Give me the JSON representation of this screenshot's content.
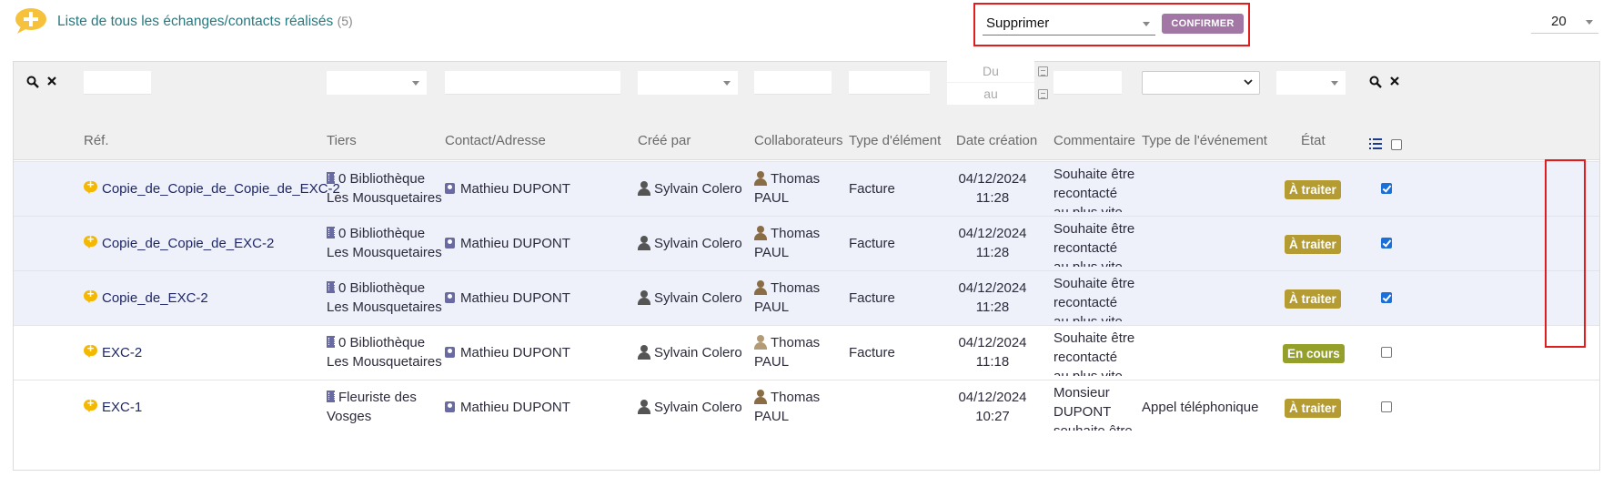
{
  "header": {
    "title": "Liste de tous les échanges/contacts réalisés",
    "count": "(5)",
    "mass_action": {
      "selected": "Supprimer",
      "confirm_label": "CONFIRMER"
    },
    "limit": "20"
  },
  "filters": {
    "date_from_placeholder": "Du",
    "date_to_placeholder": "au"
  },
  "columns": {
    "ref": "Réf.",
    "tiers": "Tiers",
    "contact": "Contact/Adresse",
    "created_by": "Créé par",
    "collaborators": "Collaborateurs",
    "element_type": "Type d'élément",
    "date_created": "Date création",
    "comment": "Commentaire",
    "event_type": "Type de l'événement",
    "state": "État"
  },
  "rows": [
    {
      "ref": "Copie_de_Copie_de_Copie_de_EXC-2",
      "tiers_1": "0 Bibliothèque",
      "tiers_2": "Les Mousquetaires",
      "contact": "Mathieu DUPONT",
      "created_by": "Sylvain Colero",
      "collab_1": "Thomas",
      "collab_2": "PAUL",
      "element_type": "Facture",
      "date": "04/12/2024",
      "time": "11:28",
      "comment_1": "Souhaite être",
      "comment_2": "recontacté",
      "comment_3": "au plus vite",
      "event_type": "",
      "state": "À traiter",
      "checked": true
    },
    {
      "ref": "Copie_de_Copie_de_EXC-2",
      "tiers_1": "0 Bibliothèque",
      "tiers_2": "Les Mousquetaires",
      "contact": "Mathieu DUPONT",
      "created_by": "Sylvain Colero",
      "collab_1": "Thomas",
      "collab_2": "PAUL",
      "element_type": "Facture",
      "date": "04/12/2024",
      "time": "11:28",
      "comment_1": "Souhaite être",
      "comment_2": "recontacté",
      "comment_3": "au plus vite",
      "event_type": "",
      "state": "À traiter",
      "checked": true
    },
    {
      "ref": "Copie_de_EXC-2",
      "tiers_1": "0 Bibliothèque",
      "tiers_2": "Les Mousquetaires",
      "contact": "Mathieu DUPONT",
      "created_by": "Sylvain Colero",
      "collab_1": "Thomas",
      "collab_2": "PAUL",
      "element_type": "Facture",
      "date": "04/12/2024",
      "time": "11:28",
      "comment_1": "Souhaite être",
      "comment_2": "recontacté",
      "comment_3": "au plus vite",
      "event_type": "",
      "state": "À traiter",
      "checked": true
    },
    {
      "ref": "EXC-2",
      "tiers_1": "0 Bibliothèque",
      "tiers_2": "Les Mousquetaires",
      "contact": "Mathieu DUPONT",
      "created_by": "Sylvain Colero",
      "collab_1": "Thomas",
      "collab_2": "PAUL",
      "element_type": "Facture",
      "date": "04/12/2024",
      "time": "11:18",
      "comment_1": "Souhaite être",
      "comment_2": "recontacté",
      "comment_3": "au plus vite",
      "event_type": "",
      "state": "En cours",
      "checked": false
    },
    {
      "ref": "EXC-1",
      "tiers_1": "Fleuriste des",
      "tiers_2": "Vosges",
      "contact": "Mathieu DUPONT",
      "created_by": "Sylvain Colero",
      "collab_1": "Thomas",
      "collab_2": "PAUL",
      "element_type": "",
      "date": "04/12/2024",
      "time": "10:27",
      "comment_1": "Monsieur",
      "comment_2": "DUPONT",
      "comment_3": "souhaite être",
      "event_type": "Appel téléphonique",
      "state": "À traiter",
      "checked": false
    }
  ]
}
